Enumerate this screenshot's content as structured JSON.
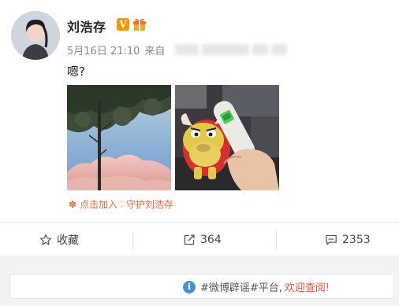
{
  "post": {
    "author": "刘浩存",
    "verified_badge": "V",
    "date": "5月16日 21:10",
    "source_label": "来自",
    "text": "嗯?",
    "guard_label": "点击加入♡守护刘浩存",
    "images": [
      {
        "name": "tree-sky-photo"
      },
      {
        "name": "plush-toy-thermometer-photo"
      }
    ]
  },
  "actions": {
    "favorite_label": "收藏",
    "repost_count": "364",
    "comment_count": "2353"
  },
  "notice": {
    "text": "#微博辟谣#平台,",
    "link": "欢迎查阅!"
  },
  "colors": {
    "badge": "#f39800",
    "guard": "#e0683c",
    "info": "#4a90d9",
    "link": "#e8523f"
  }
}
